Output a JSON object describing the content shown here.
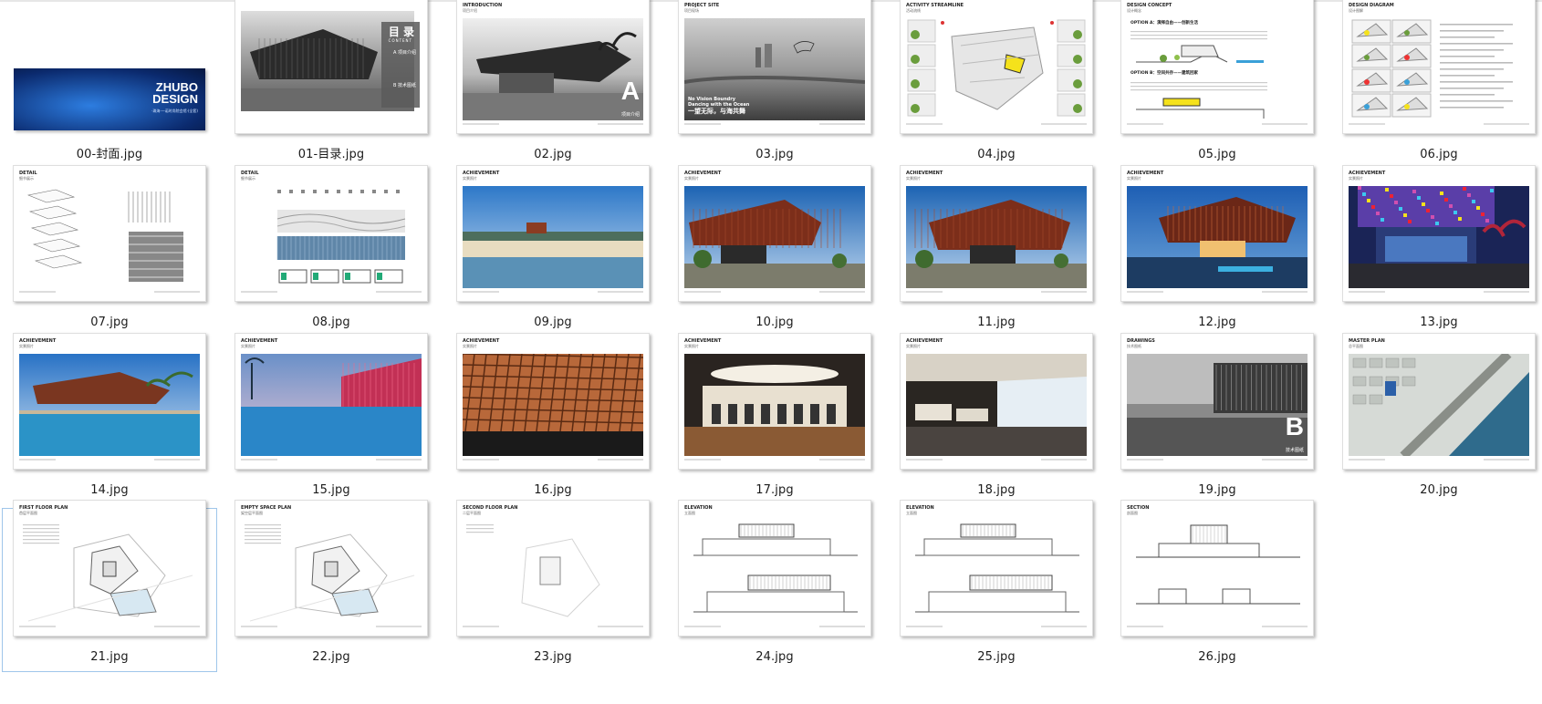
{
  "files": [
    {
      "name": "00-封面.jpg",
      "kind": "cover",
      "cover_title": "ZHUBO\nDESIGN",
      "cover_sub": "·珠海·一诺时尚院会馆·(全套)"
    },
    {
      "name": "01-目录.jpg",
      "kind": "contents",
      "big_title": "目 录",
      "big_sub": "CONTENT",
      "sec_a": "A 项目介绍",
      "sec_b": "B 技术图纸"
    },
    {
      "name": "02.jpg",
      "kind": "photo-letter",
      "title": "INTRODUCTION",
      "subtitle": "项目介绍",
      "letter": "A",
      "letter_sub": "项目介绍"
    },
    {
      "name": "03.jpg",
      "kind": "site",
      "title": "PROJECT SITE",
      "subtitle": "项目现场",
      "overlay1": "No Vision Boundry",
      "overlay2": "Dancing with the Ocean",
      "overlay3": "一望无际，与海共舞"
    },
    {
      "name": "04.jpg",
      "kind": "diagram",
      "title": "ACTIVITY STREAMLINE",
      "subtitle": "活动流线"
    },
    {
      "name": "05.jpg",
      "kind": "concept",
      "title": "DESIGN CONCEPT",
      "subtitle": "设计概念",
      "option_a": "OPTION A：演绎自由——创新生活",
      "option_b": "OPTION B：空间共存——建筑回家"
    },
    {
      "name": "06.jpg",
      "kind": "diagram2",
      "title": "DESIGN DIAGRAM",
      "subtitle": "设计图解"
    },
    {
      "name": "07.jpg",
      "kind": "detail",
      "title": "DETAIL",
      "subtitle": "细节展示"
    },
    {
      "name": "08.jpg",
      "kind": "detail2",
      "title": "DETAIL",
      "subtitle": "细节展示"
    },
    {
      "name": "09.jpg",
      "kind": "beach",
      "title": "ACHIEVEMENT",
      "subtitle": "实景照片"
    },
    {
      "name": "10.jpg",
      "kind": "building",
      "title": "ACHIEVEMENT",
      "subtitle": "实景照片"
    },
    {
      "name": "11.jpg",
      "kind": "building2",
      "title": "ACHIEVEMENT",
      "subtitle": "实景照片"
    },
    {
      "name": "12.jpg",
      "kind": "dusk",
      "title": "ACHIEVEMENT",
      "subtitle": "实景照片"
    },
    {
      "name": "13.jpg",
      "kind": "night",
      "title": "ACHIEVEMENT",
      "subtitle": "实景照片"
    },
    {
      "name": "14.jpg",
      "kind": "pool",
      "title": "ACHIEVEMENT",
      "subtitle": "实景照片"
    },
    {
      "name": "15.jpg",
      "kind": "poolnight",
      "title": "ACHIEVEMENT",
      "subtitle": "实景照片"
    },
    {
      "name": "16.jpg",
      "kind": "facade",
      "title": "ACHIEVEMENT",
      "subtitle": "实景照片"
    },
    {
      "name": "17.jpg",
      "kind": "interior",
      "title": "ACHIEVEMENT",
      "subtitle": "实景照片"
    },
    {
      "name": "18.jpg",
      "kind": "cinema",
      "title": "ACHIEVEMENT",
      "subtitle": "实景照片"
    },
    {
      "name": "19.jpg",
      "kind": "photo-letter-b",
      "title": "DRAWINGS",
      "subtitle": "技术图纸",
      "letter": "B",
      "letter_sub": "技术图纸"
    },
    {
      "name": "20.jpg",
      "kind": "master",
      "title": "MASTER PLAN",
      "subtitle": "总平面图"
    },
    {
      "name": "21.jpg",
      "kind": "plan",
      "title": "FIRST FLOOR PLAN",
      "subtitle": "首层平面图",
      "selected": true
    },
    {
      "name": "22.jpg",
      "kind": "plan",
      "title": "EMPTY SPACE PLAN",
      "subtitle": "架空层平面图"
    },
    {
      "name": "23.jpg",
      "kind": "plan2",
      "title": "SECOND FLOOR PLAN",
      "subtitle": "二层平面图"
    },
    {
      "name": "24.jpg",
      "kind": "elev",
      "title": "ELEVATION",
      "subtitle": "立面图"
    },
    {
      "name": "25.jpg",
      "kind": "elev",
      "title": "ELEVATION",
      "subtitle": "立面图"
    },
    {
      "name": "26.jpg",
      "kind": "section",
      "title": "SECTION",
      "subtitle": "剖面图"
    }
  ]
}
